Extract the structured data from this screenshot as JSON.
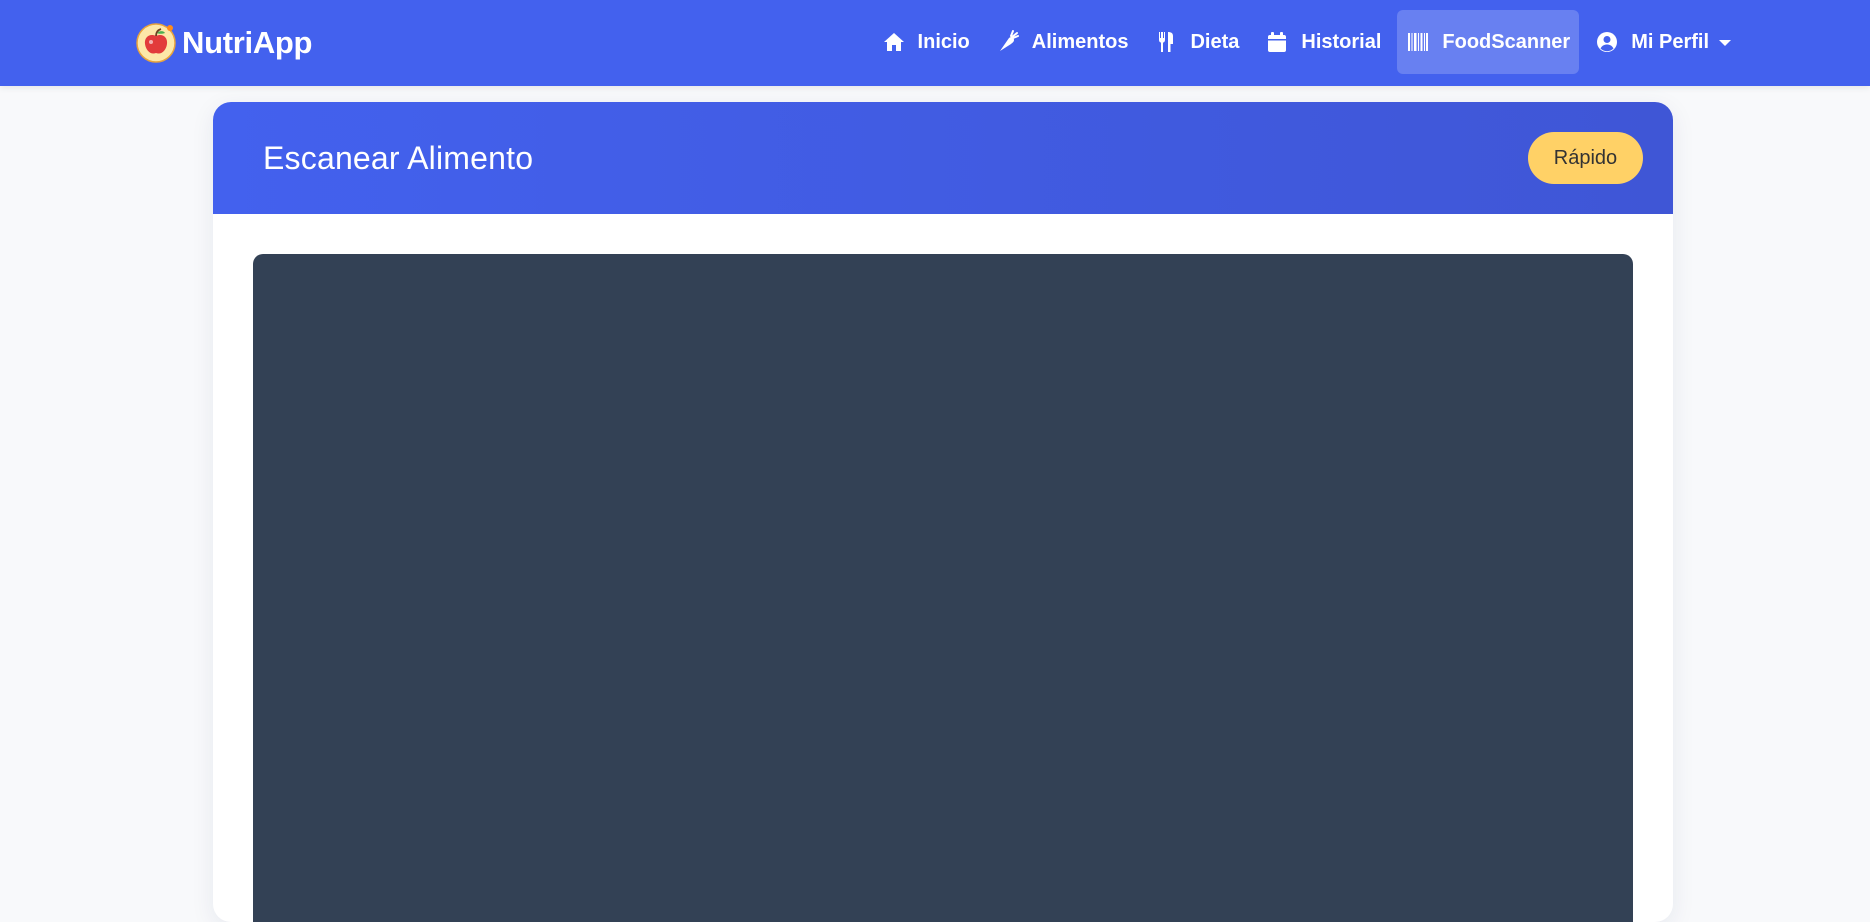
{
  "navbar": {
    "brand": "NutriApp",
    "brand_logo_icon": "apple-logo-icon",
    "accent_color": "#4361ee",
    "items": [
      {
        "label": "Inicio",
        "icon": "home-icon",
        "active": false
      },
      {
        "label": "Alimentos",
        "icon": "carrot-icon",
        "active": false
      },
      {
        "label": "Dieta",
        "icon": "utensils-icon",
        "active": false
      },
      {
        "label": "Historial",
        "icon": "calendar-icon",
        "active": false
      },
      {
        "label": "FoodScanner",
        "icon": "barcode-icon",
        "active": true
      }
    ],
    "profile": {
      "label": "Mi Perfil",
      "icon": "user-circle-icon",
      "dropdown_icon": "caret-down-icon"
    }
  },
  "scanner": {
    "title": "Escanear Alimento",
    "mode_label": "Rápido",
    "mode_color": "#ffd166",
    "camera_background": "#334155"
  }
}
